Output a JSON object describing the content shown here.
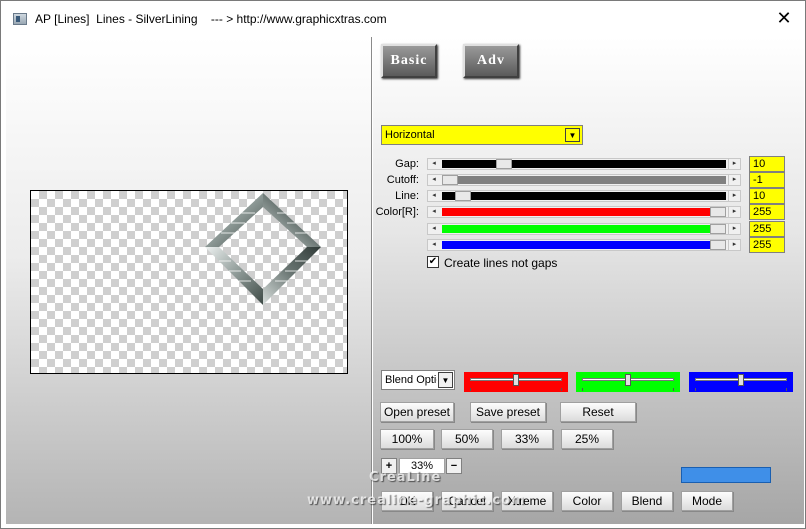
{
  "window": {
    "title": "AP [Lines]  Lines - SilverLining    --- > http://www.graphicxtras.com",
    "close_symbol": "✕"
  },
  "mode_buttons": {
    "basic": "Basic",
    "adv": "Adv"
  },
  "direction": {
    "selected": "Horizontal"
  },
  "sliders": [
    {
      "label": "Gap:",
      "value": "10",
      "position": 0.2,
      "track_color": "#000000"
    },
    {
      "label": "Cutoff:",
      "value": "-1",
      "position": 0.0,
      "track_color": "#808080"
    },
    {
      "label": "Line:",
      "value": "10",
      "position": 0.05,
      "track_color": "#000000"
    },
    {
      "label": "Color[R]:",
      "value": "255",
      "position": 1.0,
      "track_color": "#ff0000"
    },
    {
      "label": "",
      "value": "255",
      "position": 1.0,
      "track_color": "#00ff00"
    },
    {
      "label": "",
      "value": "255",
      "position": 1.0,
      "track_color": "#0000ff"
    }
  ],
  "checkbox": {
    "label": "Create lines not gaps",
    "checked": true
  },
  "blend": {
    "selected": "Blend Options",
    "sliders": [
      {
        "color": "#ff0000",
        "position": 0.5
      },
      {
        "color": "#00ff00",
        "position": 0.5
      },
      {
        "color": "#0000ff",
        "position": 0.5
      }
    ]
  },
  "preset_buttons": {
    "open": "Open preset",
    "save": "Save preset",
    "reset": "Reset"
  },
  "zoom_buttons": [
    "100%",
    "50%",
    "33%",
    "25%"
  ],
  "zoom_control": {
    "plus": "+",
    "value": "33%",
    "minus": "−"
  },
  "swatch_color": "#3f8fe8",
  "bottom_buttons": {
    "ok": "OK",
    "cancel": "Cancel",
    "xtreme": "Xtreme",
    "color": "Color",
    "blend": "Blend",
    "mode": "Mode"
  },
  "watermark": {
    "line1": "CreaLine",
    "line2": "www.crealine-graphic.com"
  }
}
